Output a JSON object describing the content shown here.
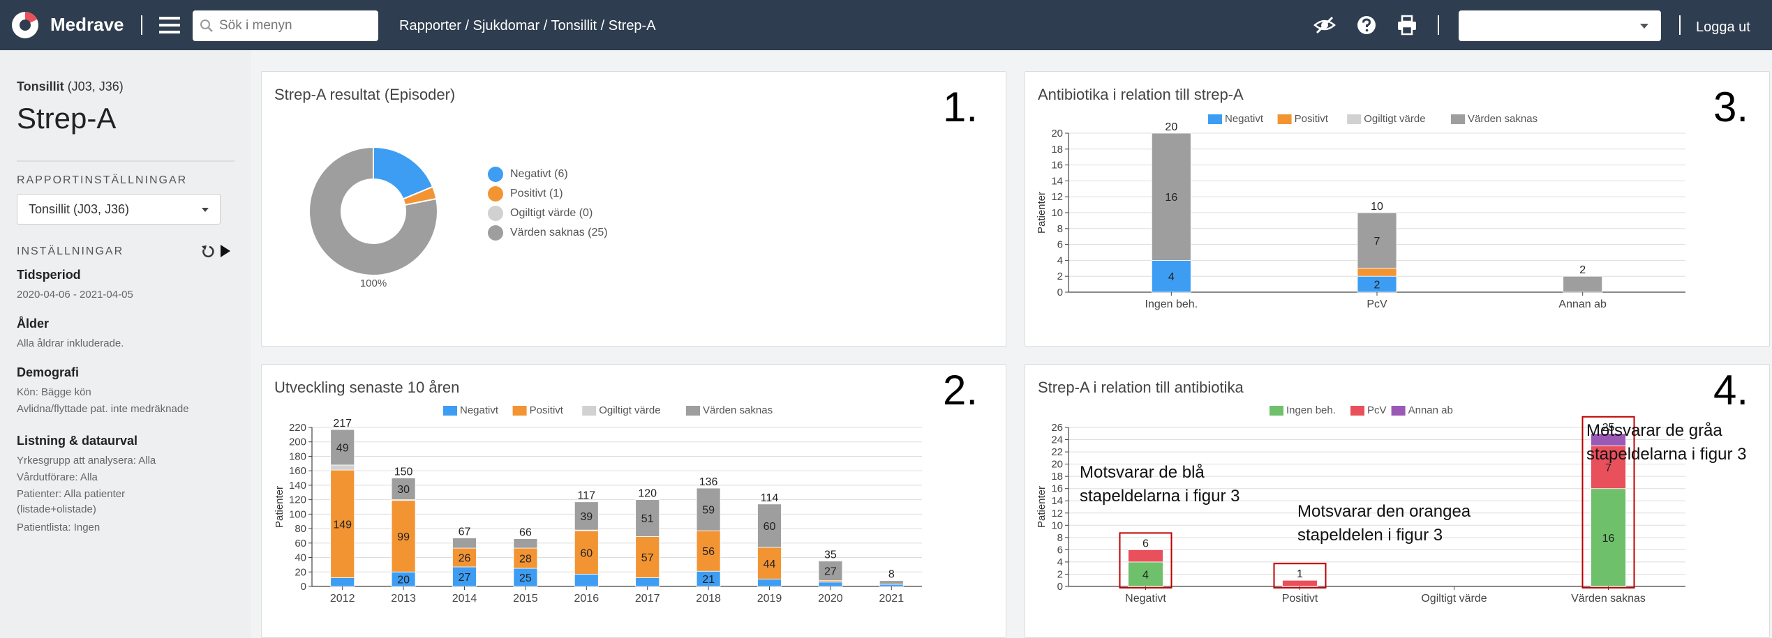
{
  "topbar": {
    "brand": "Medrave",
    "search_placeholder": "Sök i menyn",
    "breadcrumb": "Rapporter / Sjukdomar / Tonsillit / Strep-A",
    "user_select_value": "",
    "logout": "Logga ut",
    "icons": [
      "hide-eye-icon",
      "help-icon",
      "print-icon"
    ]
  },
  "sidebar": {
    "diagnosis_name": "Tonsillit",
    "diagnosis_codes": "(J03, J36)",
    "title": "Strep-A",
    "report_settings_heading": "RAPPORTINSTÄLLNINGAR",
    "report_select_value": "Tonsillit (J03, J36)",
    "settings_heading": "INSTÄLLNINGAR",
    "groups": [
      {
        "heading": "Tidsperiod",
        "lines": [
          "2020-04-06 - 2021-04-05"
        ]
      },
      {
        "heading": "Ålder",
        "lines": [
          "Alla åldrar inkluderade."
        ]
      },
      {
        "heading": "Demografi",
        "lines": [
          "Kön: Bägge kön",
          "Avlidna/flyttade pat. inte medräknade"
        ]
      },
      {
        "heading": "Listning & dataurval",
        "lines": [
          "Yrkesgrupp att analysera: Alla",
          "Vårdutförare: Alla",
          "Patienter: Alla patienter",
          "(listade+olistade)",
          "Patientlista: Ingen"
        ]
      }
    ]
  },
  "colors": {
    "negative": "#3d9df3",
    "positive": "#f39433",
    "invalid": "#d1d1d1",
    "missing": "#9e9e9e",
    "no_treatment": "#6ec06a",
    "pcv": "#e8505b",
    "other_ab": "#9b59b6",
    "annotation_box": "#c00000",
    "topbar": "#2e3d4f"
  },
  "cards": [
    {
      "number": "1.",
      "title": "Strep-A resultat (Episoder)",
      "chart_data": {
        "type": "pie",
        "donut": true,
        "labels": [
          "Negativt",
          "Positivt",
          "Ogiltigt värde",
          "Värden saknas"
        ],
        "values": [
          6,
          1,
          0,
          25
        ],
        "legend": [
          "Negativt (6)",
          "Positivt (1)",
          "Ogiltigt värde (0)",
          "Värden saknas (25)"
        ],
        "slice_label": "100%"
      }
    },
    {
      "number": "2.",
      "title": "Utveckling senaste 10 åren",
      "chart_data": {
        "type": "bar",
        "stacked": true,
        "categories": [
          "2012",
          "2013",
          "2014",
          "2015",
          "2016",
          "2017",
          "2018",
          "2019",
          "2020",
          "2021"
        ],
        "series": [
          {
            "name": "Negativt",
            "values": [
              12,
              20,
              27,
              25,
              17,
              12,
              21,
              10,
              6,
              3
            ]
          },
          {
            "name": "Positivt",
            "values": [
              149,
              99,
              26,
              28,
              60,
              57,
              56,
              44,
              2,
              0
            ]
          },
          {
            "name": "Ogiltigt värde",
            "values": [
              7,
              1,
              0,
              0,
              1,
              0,
              0,
              0,
              0,
              0
            ]
          },
          {
            "name": "Värden saknas",
            "values": [
              49,
              30,
              14,
              13,
              39,
              51,
              59,
              60,
              27,
              5
            ]
          }
        ],
        "totals": [
          217,
          150,
          67,
          66,
          117,
          120,
          136,
          114,
          35,
          8
        ],
        "segment_labels": {
          "Negativt": [
            "",
            "20",
            "27",
            "25",
            "",
            "",
            "21",
            "",
            "",
            ""
          ],
          "Positivt": [
            "149",
            "99",
            "26",
            "28",
            "60",
            "57",
            "56",
            "44",
            "",
            ""
          ],
          "Värden saknas": [
            "49",
            "30",
            "",
            "",
            "39",
            "51",
            "59",
            "60",
            "27",
            ""
          ]
        },
        "ylabel": "Patienter",
        "ylim": [
          0,
          220
        ],
        "yticks": [
          0,
          20,
          40,
          60,
          80,
          100,
          120,
          140,
          160,
          180,
          200,
          220
        ],
        "legend_position": "top"
      }
    },
    {
      "number": "3.",
      "title": "Antibiotika i relation till strep-A",
      "chart_data": {
        "type": "bar",
        "stacked": true,
        "categories": [
          "Ingen beh.",
          "PcV",
          "Annan ab"
        ],
        "series": [
          {
            "name": "Negativt",
            "values": [
              4,
              2,
              0
            ]
          },
          {
            "name": "Positivt",
            "values": [
              0,
              1,
              0
            ]
          },
          {
            "name": "Ogiltigt värde",
            "values": [
              0,
              0,
              0
            ]
          },
          {
            "name": "Värden saknas",
            "values": [
              16,
              7,
              2
            ]
          }
        ],
        "totals": [
          20,
          10,
          2
        ],
        "segment_labels": {
          "Negativt": [
            "4",
            "2",
            ""
          ],
          "Värden saknas": [
            "16",
            "7",
            ""
          ]
        },
        "ylabel": "Patienter",
        "ylim": [
          0,
          20
        ],
        "yticks": [
          0,
          2,
          4,
          6,
          8,
          10,
          12,
          14,
          16,
          18,
          20
        ],
        "legend_position": "top"
      }
    },
    {
      "number": "4.",
      "title": "Strep-A i relation till antibiotika",
      "chart_data": {
        "type": "bar",
        "stacked": true,
        "categories": [
          "Negativt",
          "Positivt",
          "Ogiltigt värde",
          "Värden saknas"
        ],
        "series": [
          {
            "name": "Ingen beh.",
            "values": [
              4,
              0,
              0,
              16
            ]
          },
          {
            "name": "PcV",
            "values": [
              2,
              1,
              0,
              7
            ]
          },
          {
            "name": "Annan ab",
            "values": [
              0,
              0,
              0,
              2
            ]
          }
        ],
        "totals": [
          6,
          1,
          0,
          25
        ],
        "segment_labels": {
          "Ingen beh.": [
            "4",
            "",
            "",
            "16"
          ],
          "PcV": [
            "",
            "",
            "",
            "7"
          ]
        },
        "ylabel": "Patienter",
        "ylim": [
          0,
          26
        ],
        "yticks": [
          0,
          2,
          4,
          6,
          8,
          10,
          12,
          14,
          16,
          18,
          20,
          22,
          24,
          26
        ],
        "legend_position": "top",
        "highlighted_categories": [
          "Negativt",
          "Positivt",
          "Värden saknas"
        ]
      },
      "annotations": [
        [
          "Motsvarar de blå",
          "stapeldelarna i figur 3"
        ],
        [
          "Motsvarar den orangea",
          "stapeldelen i figur 3"
        ],
        [
          "Motsvarar de gråa",
          "stapeldelarna i figur 3"
        ]
      ]
    }
  ]
}
